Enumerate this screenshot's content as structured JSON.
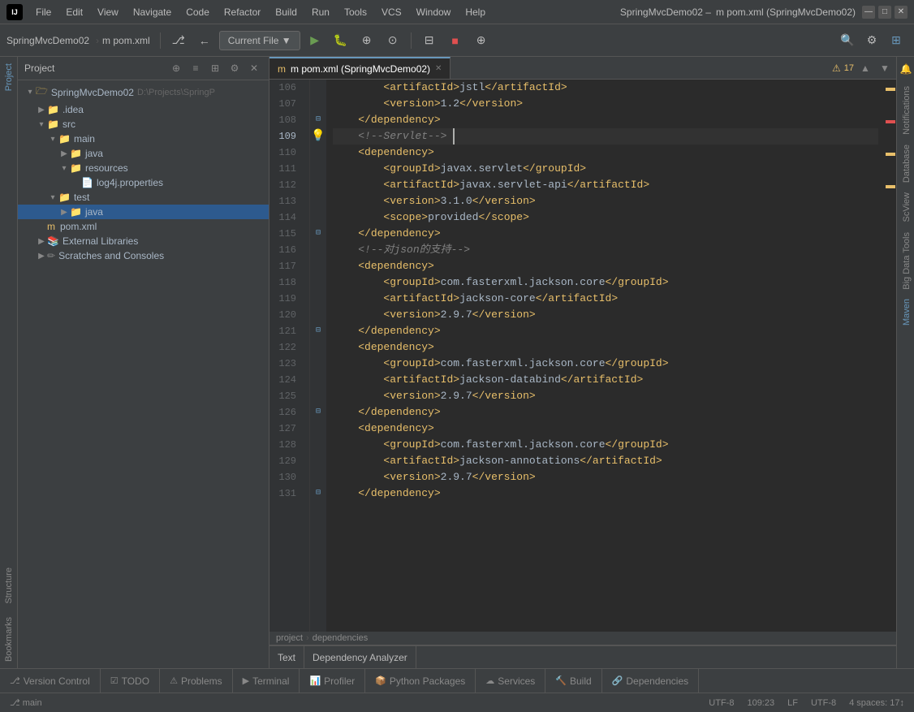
{
  "titlebar": {
    "logo": "IJ",
    "project": "SpringMvcDemo02",
    "separator": "›",
    "file": "m pom.xml",
    "menus": [
      "File",
      "Edit",
      "View",
      "Navigate",
      "Code",
      "Refactor",
      "Build",
      "Run",
      "Tools",
      "VCS",
      "Window",
      "Help"
    ]
  },
  "toolbar": {
    "project_label": "SpringMvcDemo02",
    "file_label": "m pom.xml",
    "current_file_btn": "Current File ▼",
    "run_icon": "▶",
    "debug_icon": "🐛",
    "coverage_icon": "⊕",
    "profile_icon": "⊙",
    "build_icon": "🔨",
    "search_icon": "🔍",
    "settings_icon": "⚙",
    "plugin_icon": "🔌"
  },
  "sidebar": {
    "title": "Project",
    "items": [
      {
        "label": "SpringMvcDemo02",
        "type": "project",
        "path": "D:\\Projects\\SpringP",
        "indent": 0,
        "expanded": true
      },
      {
        "label": ".idea",
        "type": "folder",
        "indent": 1,
        "expanded": false
      },
      {
        "label": "src",
        "type": "folder",
        "indent": 1,
        "expanded": true
      },
      {
        "label": "main",
        "type": "folder",
        "indent": 2,
        "expanded": true
      },
      {
        "label": "java",
        "type": "folder",
        "indent": 3,
        "expanded": false
      },
      {
        "label": "resources",
        "type": "folder",
        "indent": 3,
        "expanded": false
      },
      {
        "label": "log4j.properties",
        "type": "props",
        "indent": 4
      },
      {
        "label": "test",
        "type": "folder",
        "indent": 2,
        "expanded": true
      },
      {
        "label": "java",
        "type": "folder",
        "indent": 3,
        "selected": true,
        "expanded": false
      },
      {
        "label": "pom.xml",
        "type": "xml",
        "indent": 2
      },
      {
        "label": "External Libraries",
        "type": "external",
        "indent": 1,
        "expanded": false
      },
      {
        "label": "Scratches and Consoles",
        "type": "external",
        "indent": 1,
        "expanded": false
      }
    ]
  },
  "editor": {
    "tab_label": "m pom.xml (SpringMvcDemo02)",
    "warning_count": "17",
    "breadcrumb": [
      "project",
      "dependencies"
    ],
    "lines": [
      {
        "num": 106,
        "content": "    <artifactId>jstl</artifactId>",
        "type": "xml"
      },
      {
        "num": 107,
        "content": "    <version>1.2</version>",
        "type": "xml"
      },
      {
        "num": 108,
        "content": "</dependency>",
        "type": "xml",
        "gutter": "fold"
      },
      {
        "num": 109,
        "content": "    <!--Servlet-->",
        "type": "comment",
        "active": true,
        "hint": true
      },
      {
        "num": 110,
        "content": "<dependency>",
        "type": "xml"
      },
      {
        "num": 111,
        "content": "    <groupId>javax.servlet</groupId>",
        "type": "xml"
      },
      {
        "num": 112,
        "content": "    <artifactId>javax.servlet-api</artifactId>",
        "type": "xml"
      },
      {
        "num": 113,
        "content": "    <version>3.1.0</version>",
        "type": "xml"
      },
      {
        "num": 114,
        "content": "    <scope>provided</scope>",
        "type": "xml"
      },
      {
        "num": 115,
        "content": "</dependency>",
        "type": "xml",
        "gutter": "fold"
      },
      {
        "num": 116,
        "content": "<!--对json的支持-->",
        "type": "comment"
      },
      {
        "num": 117,
        "content": "<dependency>",
        "type": "xml"
      },
      {
        "num": 118,
        "content": "    <groupId>com.fasterxml.jackson.core</groupId>",
        "type": "xml"
      },
      {
        "num": 119,
        "content": "    <artifactId>jackson-core</artifactId>",
        "type": "xml"
      },
      {
        "num": 120,
        "content": "    <version>2.9.7</version>",
        "type": "xml"
      },
      {
        "num": 121,
        "content": "</dependency>",
        "type": "xml",
        "gutter": "fold"
      },
      {
        "num": 122,
        "content": "<dependency>",
        "type": "xml"
      },
      {
        "num": 123,
        "content": "    <groupId>com.fasterxml.jackson.core</groupId>",
        "type": "xml"
      },
      {
        "num": 124,
        "content": "    <artifactId>jackson-databind</artifactId>",
        "type": "xml"
      },
      {
        "num": 125,
        "content": "    <version>2.9.7</version>",
        "type": "xml"
      },
      {
        "num": 126,
        "content": "</dependency>",
        "type": "xml",
        "gutter": "fold"
      },
      {
        "num": 127,
        "content": "<dependency>",
        "type": "xml"
      },
      {
        "num": 128,
        "content": "    <groupId>com.fasterxml.jackson.core</groupId>",
        "type": "xml"
      },
      {
        "num": 129,
        "content": "    <artifactId>jackson-annotations</artifactId>",
        "type": "xml"
      },
      {
        "num": 130,
        "content": "    <version>2.9.7</version>",
        "type": "xml"
      },
      {
        "num": 131,
        "content": "</dependency>",
        "type": "xml",
        "gutter": "fold"
      }
    ]
  },
  "bottom_tabs": [
    {
      "label": "Version Control",
      "icon": "⎇",
      "active": false
    },
    {
      "label": "TODO",
      "icon": "☑",
      "active": false
    },
    {
      "label": "Problems",
      "icon": "⚠",
      "active": false
    },
    {
      "label": "Terminal",
      "icon": "▶",
      "active": false
    },
    {
      "label": "Profiler",
      "icon": "📊",
      "active": false
    },
    {
      "label": "Python Packages",
      "icon": "📦",
      "active": false
    },
    {
      "label": "Services",
      "icon": "☁",
      "active": false
    },
    {
      "label": "Build",
      "icon": "🔨",
      "active": false
    },
    {
      "label": "Dependencies",
      "icon": "🔗",
      "active": false
    }
  ],
  "tab_labels_editor": [
    {
      "label": "Text",
      "active": false
    },
    {
      "label": "Dependency Analyzer",
      "active": false
    }
  ],
  "status_bar": {
    "encoding": "UTF-8",
    "line_col": "109:23",
    "line_separator": "LF",
    "indent": "UTF-8",
    "spaces": "4 spaces: 17&#5117;"
  },
  "right_panels": {
    "notifications": "Notifications",
    "database": "Database",
    "scview": "ScView",
    "big_data_tools": "Big Data Tools",
    "maven": "Maven"
  }
}
